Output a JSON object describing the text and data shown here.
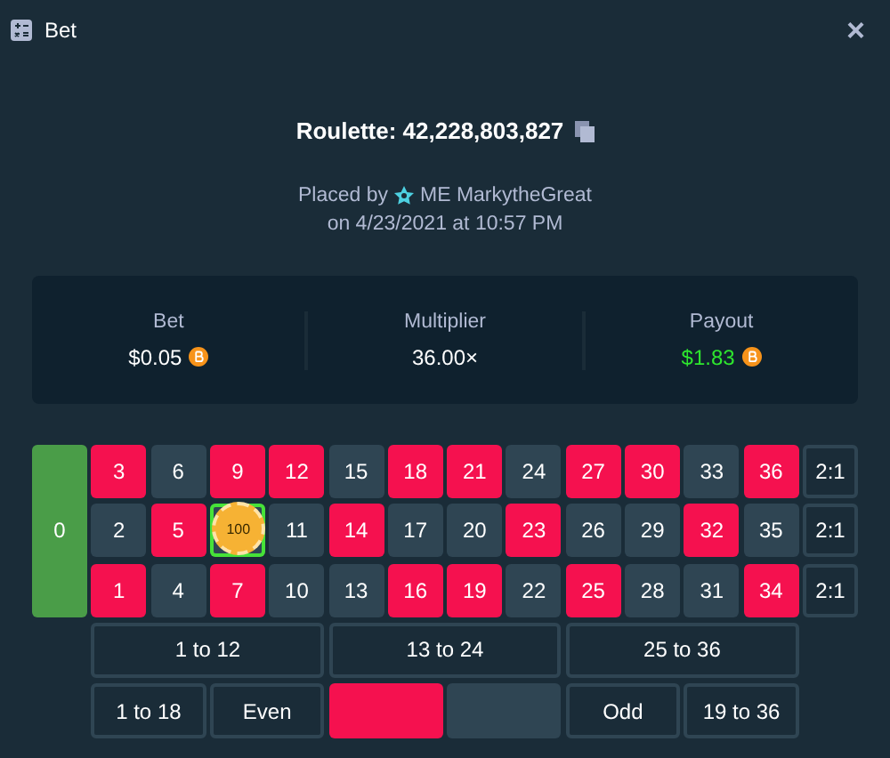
{
  "window": {
    "title": "Bet",
    "close": "×"
  },
  "game": {
    "title": "Roulette: 42,228,803,827",
    "placed_by": "Placed by",
    "user": "ME MarkytheGreat",
    "date": "on 4/23/2021 at 10:57 PM"
  },
  "stats": [
    {
      "label": "Bet",
      "value": "$0.05",
      "coin": true,
      "win": false
    },
    {
      "label": "Multiplier",
      "value": "36.00×",
      "coin": false,
      "win": false
    },
    {
      "label": "Payout",
      "value": "$1.83",
      "coin": true,
      "win": true
    }
  ],
  "board": {
    "zero": {
      "label": "0",
      "color": "#4a9d48"
    },
    "rows": [
      {
        "cells": [
          {
            "label": "3",
            "color": "#f5114f",
            "selected": false
          },
          {
            "label": "6",
            "color": "#2f4553",
            "selected": false
          },
          {
            "label": "9",
            "color": "#f5114f",
            "selected": false
          },
          {
            "label": "12",
            "color": "#f5114f",
            "selected": false
          },
          {
            "label": "15",
            "color": "#2f4553",
            "selected": false
          },
          {
            "label": "18",
            "color": "#f5114f",
            "selected": false
          },
          {
            "label": "21",
            "color": "#f5114f",
            "selected": false
          },
          {
            "label": "24",
            "color": "#2f4553",
            "selected": false
          },
          {
            "label": "27",
            "color": "#f5114f",
            "selected": false
          },
          {
            "label": "30",
            "color": "#f5114f",
            "selected": false
          },
          {
            "label": "33",
            "color": "#2f4553",
            "selected": false
          },
          {
            "label": "36",
            "color": "#f5114f",
            "selected": false
          }
        ],
        "column_bet": "2:1"
      },
      {
        "cells": [
          {
            "label": "2",
            "color": "#2f4553",
            "selected": false
          },
          {
            "label": "5",
            "color": "#f5114f",
            "selected": false
          },
          {
            "chip": "100",
            "color": "#2f4553",
            "selected": true
          },
          {
            "label": "11",
            "color": "#2f4553",
            "selected": false
          },
          {
            "label": "14",
            "color": "#f5114f",
            "selected": false
          },
          {
            "label": "17",
            "color": "#2f4553",
            "selected": false
          },
          {
            "label": "20",
            "color": "#2f4553",
            "selected": false
          },
          {
            "label": "23",
            "color": "#f5114f",
            "selected": false
          },
          {
            "label": "26",
            "color": "#2f4553",
            "selected": false
          },
          {
            "label": "29",
            "color": "#2f4553",
            "selected": false
          },
          {
            "label": "32",
            "color": "#f5114f",
            "selected": false
          },
          {
            "label": "35",
            "color": "#2f4553",
            "selected": false
          }
        ],
        "column_bet": "2:1"
      },
      {
        "cells": [
          {
            "label": "1",
            "color": "#f5114f",
            "selected": false
          },
          {
            "label": "4",
            "color": "#2f4553",
            "selected": false
          },
          {
            "label": "7",
            "color": "#f5114f",
            "selected": false
          },
          {
            "label": "10",
            "color": "#2f4553",
            "selected": false
          },
          {
            "label": "13",
            "color": "#2f4553",
            "selected": false
          },
          {
            "label": "16",
            "color": "#f5114f",
            "selected": false
          },
          {
            "label": "19",
            "color": "#f5114f",
            "selected": false
          },
          {
            "label": "22",
            "color": "#2f4553",
            "selected": false
          },
          {
            "label": "25",
            "color": "#f5114f",
            "selected": false
          },
          {
            "label": "28",
            "color": "#2f4553",
            "selected": false
          },
          {
            "label": "31",
            "color": "#2f4553",
            "selected": false
          },
          {
            "label": "34",
            "color": "#f5114f",
            "selected": false
          }
        ],
        "column_bet": "2:1"
      }
    ],
    "dozens": [
      "1 to 12",
      "13 to 24",
      "25 to 36"
    ],
    "outside": [
      {
        "kind": "text",
        "label": "1 to 18"
      },
      {
        "kind": "text",
        "label": "Even"
      },
      {
        "kind": "swatch",
        "color": "#f5114f"
      },
      {
        "kind": "swatch",
        "color": "#2f4553"
      },
      {
        "kind": "text",
        "label": "Odd"
      },
      {
        "kind": "text",
        "label": "19 to 36"
      }
    ]
  }
}
